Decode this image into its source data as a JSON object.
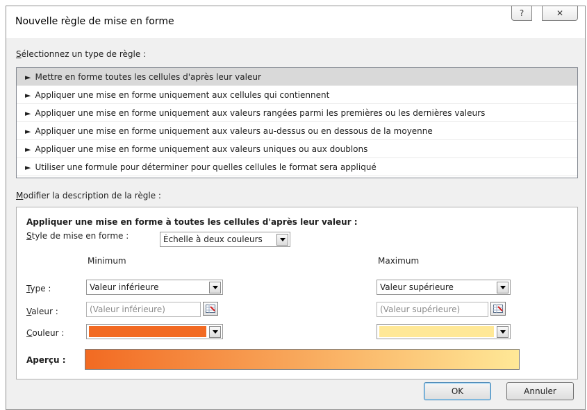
{
  "dialog": {
    "title": "Nouvelle règle de mise en forme",
    "help_glyph": "?",
    "close_glyph": "✕"
  },
  "rule_type": {
    "label_accel": "S",
    "label_rest": "électionnez un type de règle :",
    "items": [
      {
        "arrow": "►",
        "label": "Mettre en forme toutes les cellules d'après leur valeur"
      },
      {
        "arrow": "►",
        "label": "Appliquer une mise en forme uniquement aux cellules qui contiennent"
      },
      {
        "arrow": "►",
        "label": "Appliquer une mise en forme uniquement aux valeurs rangées parmi les premières ou les dernières valeurs"
      },
      {
        "arrow": "►",
        "label": "Appliquer une mise en forme uniquement aux valeurs au-dessus ou en dessous de la moyenne"
      },
      {
        "arrow": "►",
        "label": "Appliquer une mise en forme uniquement aux valeurs uniques ou aux doublons"
      },
      {
        "arrow": "►",
        "label": "Utiliser une formule pour déterminer pour quelles cellules le format sera appliqué"
      }
    ]
  },
  "description": {
    "label_accel": "M",
    "label_rest": "odifier la description de la règle :",
    "heading": "Appliquer une mise en forme à toutes les cellules d'après leur valeur :",
    "style_label_accel": "S",
    "style_label_rest": "tyle de mise en forme :",
    "style_value": "Échelle à deux couleurs",
    "minimum_header": "Minimum",
    "maximum_header": "Maximum",
    "type_label_accel": "T",
    "type_label_rest": "ype :",
    "value_label_accel": "V",
    "value_label_rest": "aleur :",
    "color_label_accel": "C",
    "color_label_rest": "ouleur :",
    "min_type": "Valeur inférieure",
    "max_type": "Valeur supérieure",
    "min_value": "(Valeur inférieure)",
    "max_value": "(Valeur supérieure)",
    "min_color": "#f26a22",
    "max_color": "#ffe897",
    "preview_label": "Aperçu :"
  },
  "buttons": {
    "ok": "OK",
    "cancel": "Annuler"
  }
}
